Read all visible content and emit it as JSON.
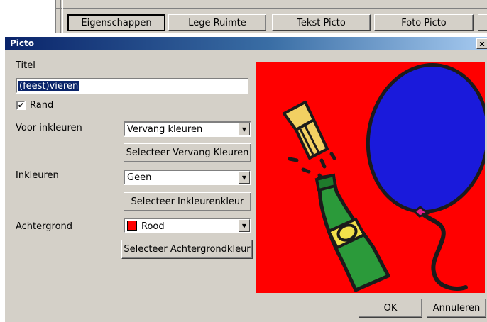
{
  "toolbar": {
    "buttons": [
      {
        "label": "Eigenschappen",
        "pressed": true
      },
      {
        "label": "Lege Ruimte"
      },
      {
        "label": "Tekst Picto"
      },
      {
        "label": "Foto Picto"
      }
    ]
  },
  "dialog": {
    "title": "Picto",
    "close_glyph": "x",
    "title_label": "Titel",
    "title_value": "(feest)vieren",
    "border_checkbox": {
      "label": "Rand",
      "checked": true,
      "glyph": "✔"
    },
    "pre_color": {
      "label": "Voor inkleuren",
      "value": "Vervang kleuren",
      "button": "Selecteer Vervang Kleuren"
    },
    "fill_color": {
      "label": "Inkleuren",
      "value": "Geen",
      "button": "Selecteer Inkleurenkleur"
    },
    "background": {
      "label": "Achtergrond",
      "value": "Rood",
      "swatch_color": "#ff0000",
      "button": "Selecteer Achtergrondkleur"
    },
    "ok_label": "OK",
    "cancel_label": "Annuleren",
    "picto_icons": [
      "champagne-bottle-icon",
      "cork-icon",
      "balloon-icon"
    ],
    "picto_background": "#ff0000"
  }
}
